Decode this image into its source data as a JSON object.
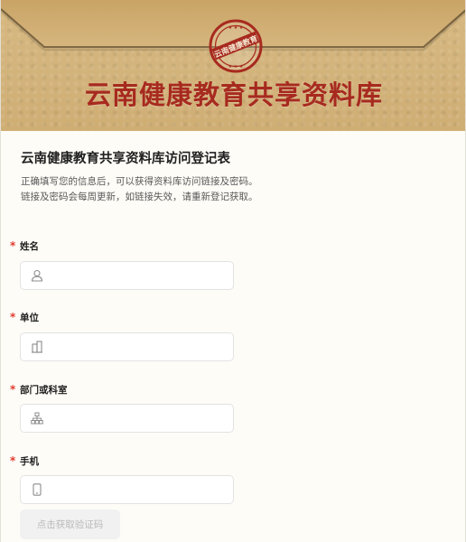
{
  "banner": {
    "title": "云南健康教育共享资料库",
    "stamp_text": "云南健康教育",
    "title_color": "#a72a1f",
    "background_color": "#d3b47c"
  },
  "form": {
    "title": "云南健康教育共享资料库访问登记表",
    "description_line1": "正确填写您的信息后，可以获得资料库访问链接及密码。",
    "description_line2": "链接及密码会每周更新，如链接失效，请重新登记获取。",
    "required_mark": "*",
    "fields": [
      {
        "label": "姓名",
        "icon": "user-icon",
        "value": "",
        "placeholder": ""
      },
      {
        "label": "单位",
        "icon": "building-icon",
        "value": "",
        "placeholder": ""
      },
      {
        "label": "部门或科室",
        "icon": "org-chart-icon",
        "value": "",
        "placeholder": ""
      },
      {
        "label": "手机",
        "icon": "phone-icon",
        "value": "",
        "placeholder": ""
      }
    ],
    "get_code_label": "点击获取验证码"
  }
}
